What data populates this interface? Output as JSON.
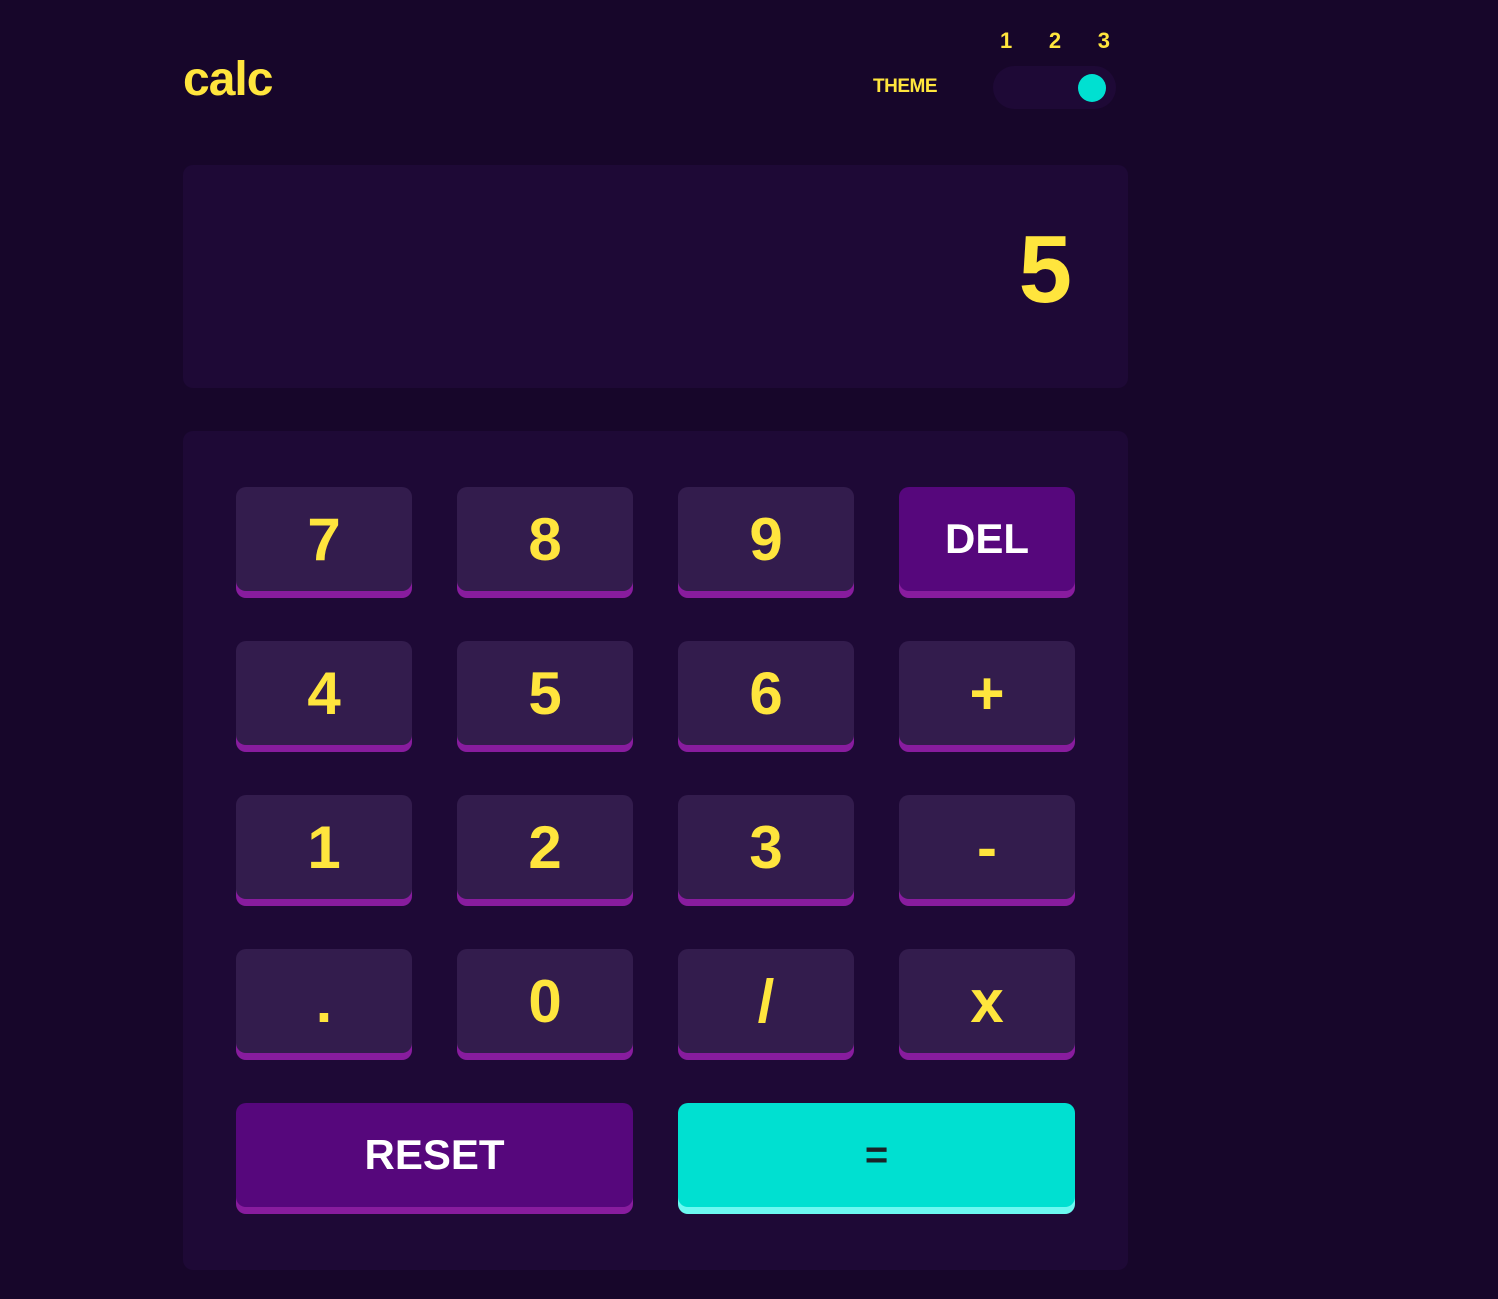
{
  "header": {
    "logo": "calc",
    "theme_label": "THEME",
    "theme_options": [
      "1",
      "2",
      "3"
    ],
    "selected_theme": 3
  },
  "display": {
    "value": "5"
  },
  "keys": [
    "7",
    "8",
    "9",
    "DEL",
    "4",
    "5",
    "6",
    "+",
    "1",
    "2",
    "3",
    "-",
    ".",
    "0",
    "/",
    "x"
  ],
  "reset_label": "RESET",
  "equals_label": "=",
  "colors": {
    "background": "#17062a",
    "panel": "#1e0936",
    "key": "#331c4d",
    "key_shadow": "#881c9e",
    "text": "#ffe53d",
    "accent_key": "#56077c",
    "equals": "#00e0d1"
  }
}
